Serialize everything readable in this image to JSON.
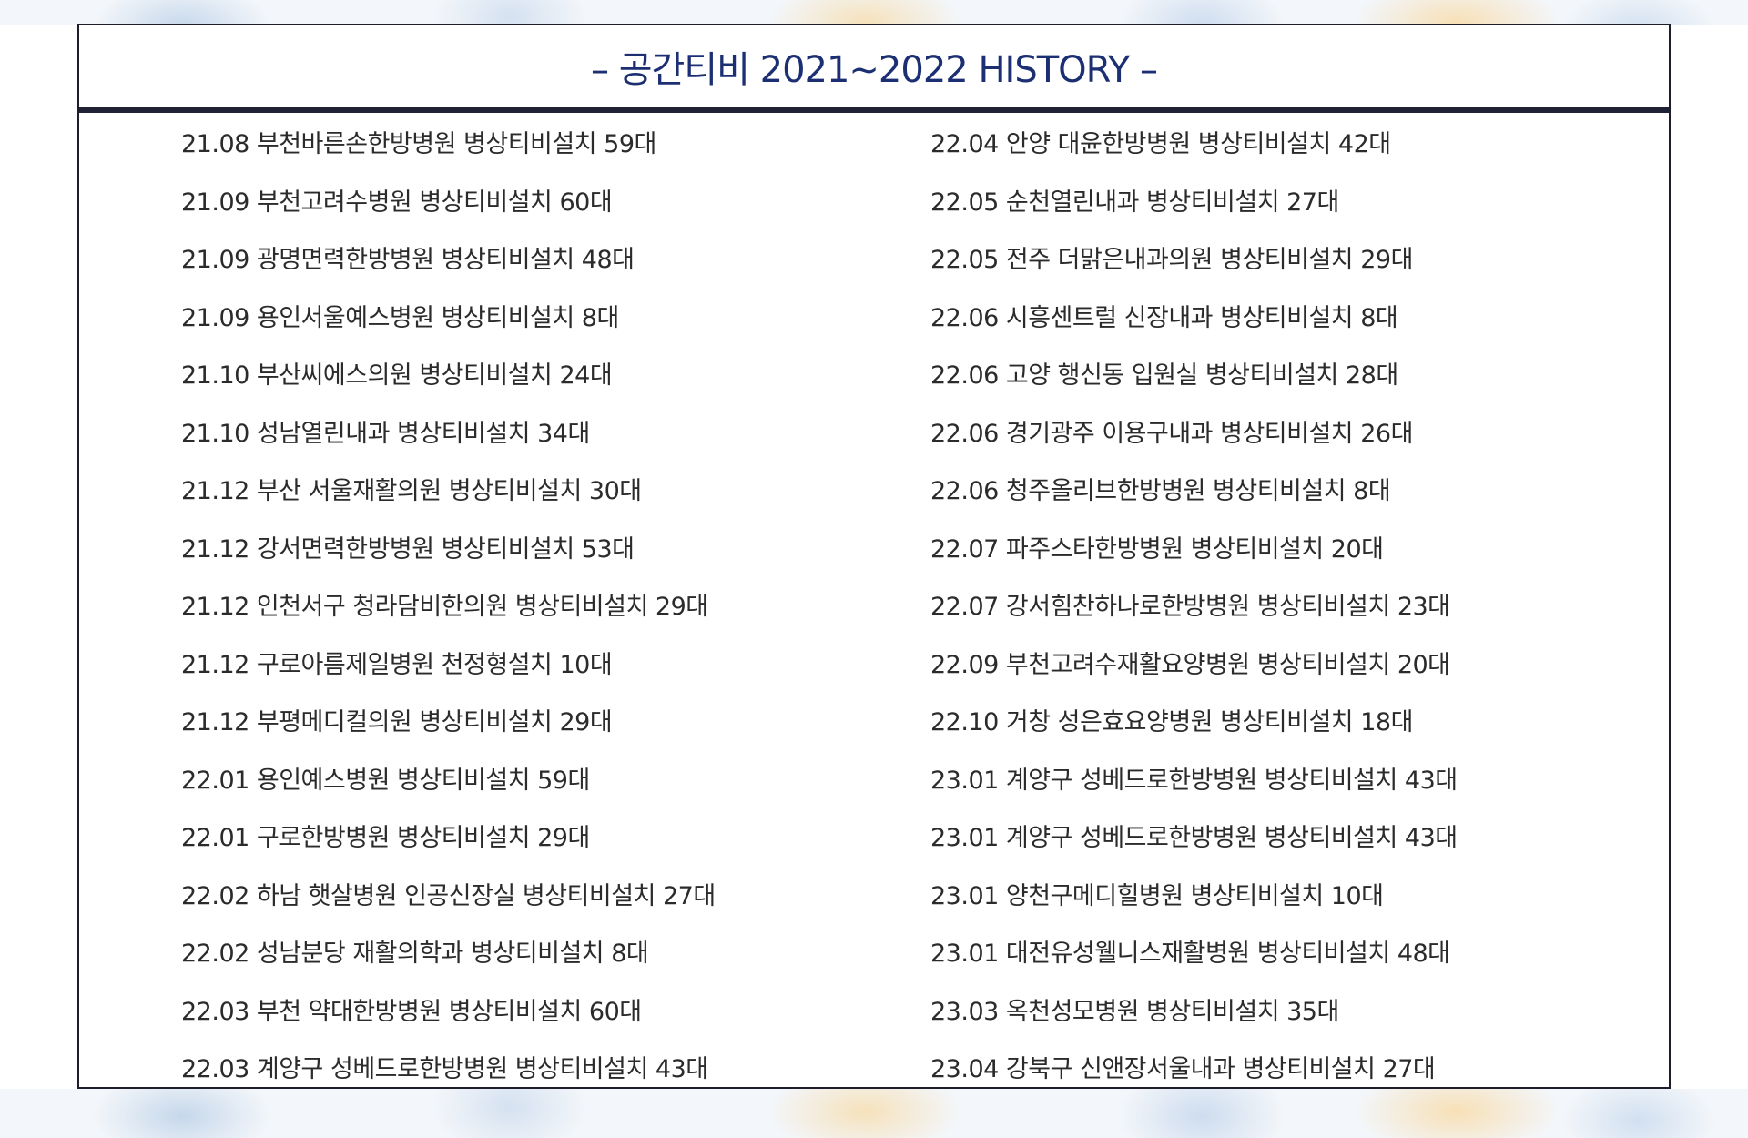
{
  "title": "– 공간티비 2021~2022 HISTORY –",
  "left_items": [
    "21.08 부천바른손한방병원 병상티비설치 59대",
    "21.09 부천고려수병원 병상티비설치 60대",
    "21.09 광명면력한방병원 병상티비설치 48대",
    "21.09 용인서울예스병원 병상티비설치 8대",
    "21.10 부산씨에스의원 병상티비설치 24대",
    "21.10 성남열린내과 병상티비설치 34대",
    "21.12 부산 서울재활의원 병상티비설치 30대",
    "21.12 강서면력한방병원 병상티비설치 53대",
    "21.12 인천서구 청라담비한의원 병상티비설치 29대",
    "21.12 구로아름제일병원 천정형설치 10대",
    "21.12 부평메디컬의원 병상티비설치 29대",
    "22.01 용인예스병원 병상티비설치 59대",
    "22.01 구로한방병원 병상티비설치 29대",
    "22.02 하남 햇살병원 인공신장실 병상티비설치 27대",
    "22.02 성남분당 재활의학과 병상티비설치 8대",
    "22.03 부천 약대한방병원 병상티비설치 60대",
    "22.03 계양구 성베드로한방병원 병상티비설치 43대"
  ],
  "right_items": [
    "22.04 안양 대윤한방병원 병상티비설치 42대",
    "22.05 순천열린내과 병상티비설치 27대",
    "22.05 전주 더맑은내과의원 병상티비설치 29대",
    "22.06 시흥센트럴 신장내과 병상티비설치 8대",
    "22.06 고양 행신동 입원실 병상티비설치 28대",
    "22.06 경기광주 이용구내과 병상티비설치 26대",
    "22.06 청주올리브한방병원 병상티비설치 8대",
    "22.07 파주스타한방병원 병상티비설치 20대",
    "22.07 강서힘찬하나로한방병원 병상티비설치 23대",
    "22.09 부천고려수재활요양병원 병상티비설치 20대",
    "22.10 거창 성은효요양병원 병상티비설치 18대",
    "23.01 계양구 성베드로한방병원 병상티비설치 43대",
    "23.01 계양구 성베드로한방병원 병상티비설치 43대",
    "23.01 양천구메디힐병원 병상티비설치 10대",
    "23.01 대전유성웰니스재활병원 병상티비설치 48대",
    "23.03 옥천성모병원 병상티비설치 35대",
    "23.04 강북구 신앤장서울내과 병상티비설치 27대"
  ]
}
